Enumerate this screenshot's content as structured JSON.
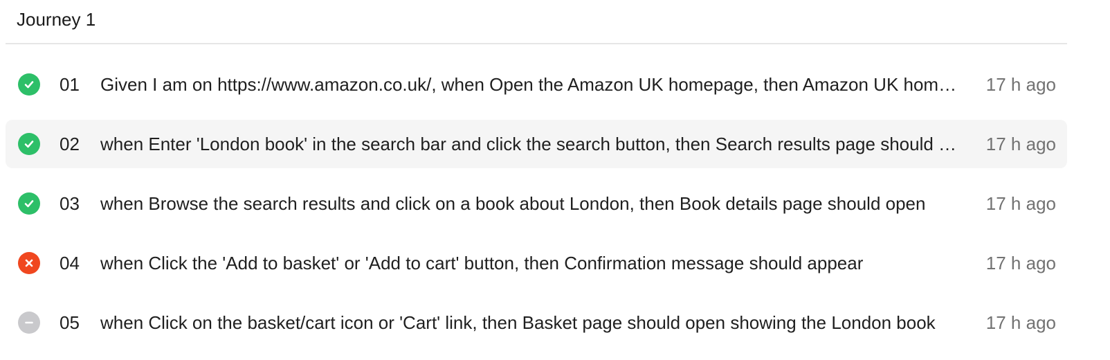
{
  "journey": {
    "title": "Journey 1"
  },
  "steps": [
    {
      "number": "01",
      "status": "passed",
      "status_icon": "check-circle-icon",
      "text": "Given I am on https://www.amazon.co.uk/, when Open the Amazon UK homepage, then Amazon UK homepage should load successfully",
      "time": "17 h ago"
    },
    {
      "number": "02",
      "status": "passed",
      "status_icon": "check-circle-icon",
      "text": "when Enter 'London book' in the search bar and click the search button, then Search results page should display books related to London",
      "time": "17 h ago"
    },
    {
      "number": "03",
      "status": "passed",
      "status_icon": "check-circle-icon",
      "text": "when Browse the search results and click on a book about London, then Book details page should open",
      "time": "17 h ago"
    },
    {
      "number": "04",
      "status": "failed",
      "status_icon": "x-circle-icon",
      "text": "when Click the 'Add to basket' or 'Add to cart' button, then Confirmation message should appear",
      "time": "17 h ago"
    },
    {
      "number": "05",
      "status": "skipped",
      "status_icon": "minus-circle-icon",
      "text": "when Click on the basket/cart icon or 'Cart' link, then Basket page should open showing the London book",
      "time": "17 h ago"
    }
  ],
  "colors": {
    "passed": "#2dbf68",
    "failed": "#f0471f",
    "skipped": "#c9c9cc",
    "row_highlight": "#f5f5f5",
    "muted_text": "#727272",
    "divider": "#e6e6e6"
  }
}
